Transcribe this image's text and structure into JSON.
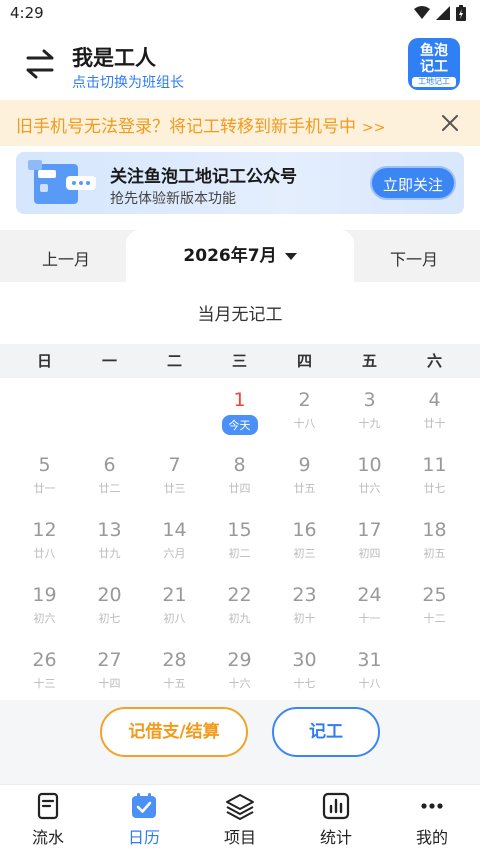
{
  "status": {
    "time": "4:29"
  },
  "header": {
    "title": "我是工人",
    "subtitle": "点击切换为班组长",
    "logo_line1": "鱼泡",
    "logo_line2": "记工",
    "logo_line3": "工地记工"
  },
  "notice": {
    "text": "旧手机号无法登录？将记工转移到新手机号中",
    "arrow": ">>"
  },
  "banner": {
    "title": "关注鱼泡工地记工公众号",
    "subtitle": "抢先体验新版本功能",
    "button": "立即关注"
  },
  "month_nav": {
    "prev": "上一月",
    "current": "2026年7月",
    "next": "下一月"
  },
  "summary": "当月无记工",
  "weekdays": [
    "日",
    "一",
    "二",
    "三",
    "四",
    "五",
    "六"
  ],
  "calendar": {
    "first_weekday_index": 3,
    "days": [
      {
        "d": "1",
        "l": "今天",
        "today": true
      },
      {
        "d": "2",
        "l": "十八"
      },
      {
        "d": "3",
        "l": "十九"
      },
      {
        "d": "4",
        "l": "廿十"
      },
      {
        "d": "5",
        "l": "廿一"
      },
      {
        "d": "6",
        "l": "廿二"
      },
      {
        "d": "7",
        "l": "廿三"
      },
      {
        "d": "8",
        "l": "廿四"
      },
      {
        "d": "9",
        "l": "廿五"
      },
      {
        "d": "10",
        "l": "廿六"
      },
      {
        "d": "11",
        "l": "廿七"
      },
      {
        "d": "12",
        "l": "廿八"
      },
      {
        "d": "13",
        "l": "廿九"
      },
      {
        "d": "14",
        "l": "六月"
      },
      {
        "d": "15",
        "l": "初二"
      },
      {
        "d": "16",
        "l": "初三"
      },
      {
        "d": "17",
        "l": "初四"
      },
      {
        "d": "18",
        "l": "初五"
      },
      {
        "d": "19",
        "l": "初六"
      },
      {
        "d": "20",
        "l": "初七"
      },
      {
        "d": "21",
        "l": "初八"
      },
      {
        "d": "22",
        "l": "初九"
      },
      {
        "d": "23",
        "l": "初十"
      },
      {
        "d": "24",
        "l": "十一"
      },
      {
        "d": "25",
        "l": "十二"
      },
      {
        "d": "26",
        "l": "十三"
      },
      {
        "d": "27",
        "l": "十四"
      },
      {
        "d": "28",
        "l": "十五"
      },
      {
        "d": "29",
        "l": "十六"
      },
      {
        "d": "30",
        "l": "十七"
      },
      {
        "d": "31",
        "l": "十八"
      }
    ]
  },
  "actions": {
    "loan": "记借支/结算",
    "record": "记工"
  },
  "tabs": [
    {
      "label": "流水",
      "icon": "ledger-icon"
    },
    {
      "label": "日历",
      "icon": "calendar-icon",
      "active": true
    },
    {
      "label": "项目",
      "icon": "layers-icon"
    },
    {
      "label": "统计",
      "icon": "chart-icon"
    },
    {
      "label": "我的",
      "icon": "more-icon"
    }
  ],
  "colors": {
    "accent": "#2f7cf6",
    "warning": "#f29a1c",
    "today": "#f0443a"
  }
}
